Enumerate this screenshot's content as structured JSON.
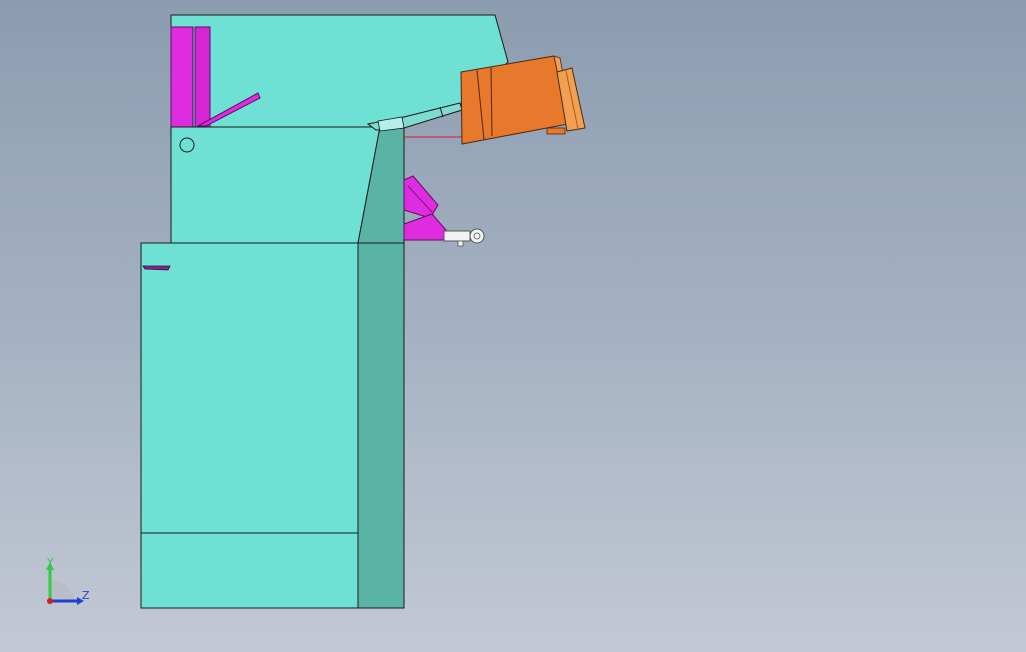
{
  "viewport": {
    "name": "3d-cad-viewport",
    "background_top": "#8c9cb0",
    "background_bottom": "#c3c9d4"
  },
  "model": {
    "body_color": "#6ee0d4",
    "body_side_color": "#5ab4a6",
    "accent_color": "#e02ce0",
    "hopper_color": "#e8782c",
    "hopper_edge_color": "#f0a050"
  },
  "triad": {
    "y_label": "Y",
    "z_label": "Z",
    "y_color": "#2ecc40",
    "z_color": "#1f3fd6",
    "x_color": "#d62020"
  }
}
